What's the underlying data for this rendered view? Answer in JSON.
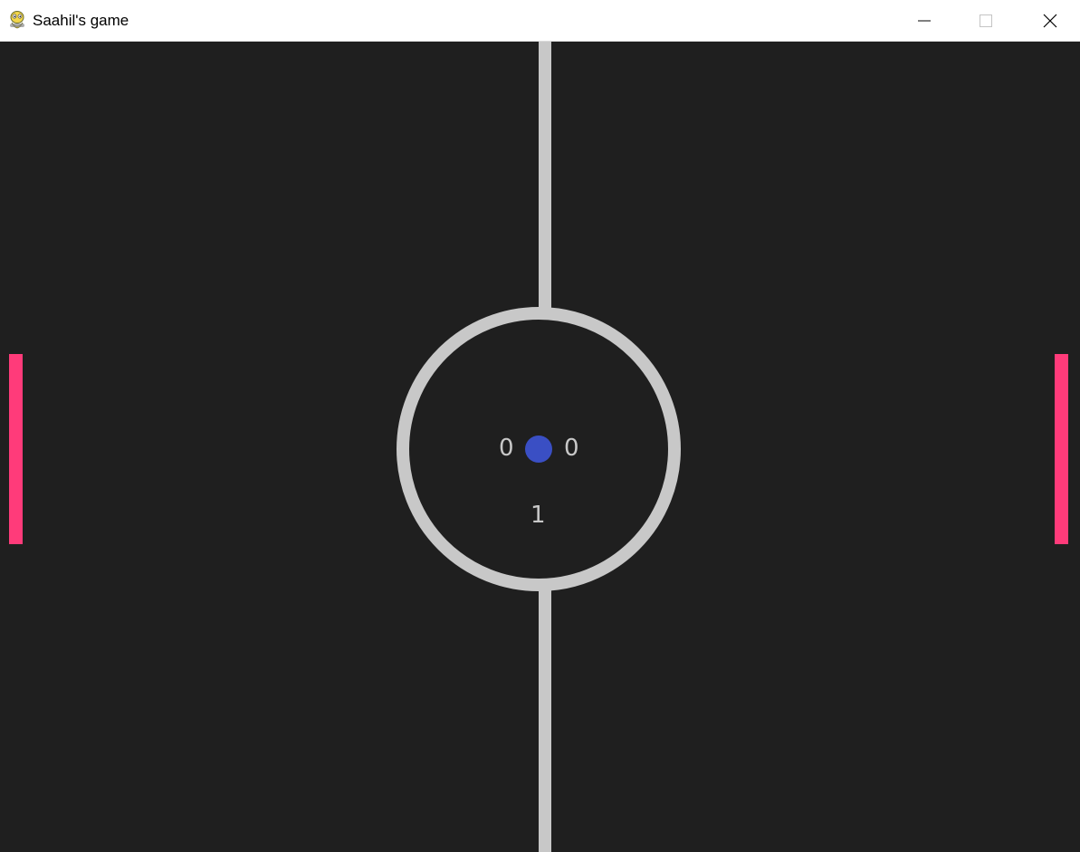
{
  "window": {
    "title": "Saahil's game",
    "icon": "pygame-snake-icon",
    "buttons": [
      "minimize",
      "maximize",
      "close"
    ]
  },
  "game": {
    "background_color": "#1f1f1f",
    "field_line_color": "#c8c8c8",
    "paddle_color": "#ff3b7a",
    "ball_color": "#3a4fc4",
    "score_left": "0",
    "score_right": "0",
    "round": "1"
  }
}
